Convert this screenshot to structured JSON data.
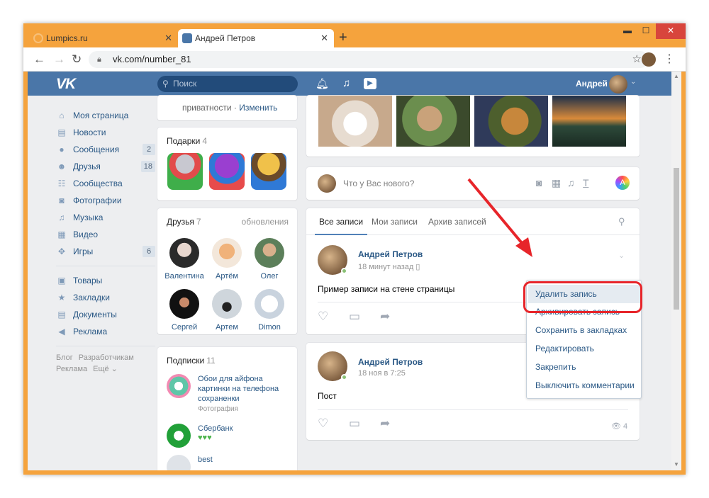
{
  "browser": {
    "tabs": [
      {
        "title": "Lumpics.ru",
        "active": false
      },
      {
        "title": "Андрей Петров",
        "active": true
      }
    ],
    "new_tab": "+",
    "url": "vk.com/number_81",
    "close_glyph": "✕",
    "minimize_glyph": "▬",
    "maximize_glyph": "☐"
  },
  "vk": {
    "logo": "VK",
    "search_placeholder": "Поиск",
    "user_name": "Андрей",
    "left_nav": [
      {
        "label": "Моя страница",
        "icon": "home-icon",
        "glyph": "⌂",
        "count": ""
      },
      {
        "label": "Новости",
        "icon": "news-icon",
        "glyph": "▤",
        "count": ""
      },
      {
        "label": "Сообщения",
        "icon": "messages-icon",
        "glyph": "●",
        "count": "2"
      },
      {
        "label": "Друзья",
        "icon": "friends-icon",
        "glyph": "☻",
        "count": "18"
      },
      {
        "label": "Сообщества",
        "icon": "communities-icon",
        "glyph": "☷",
        "count": ""
      },
      {
        "label": "Фотографии",
        "icon": "camera-icon",
        "glyph": "◙",
        "count": ""
      },
      {
        "label": "Музыка",
        "icon": "music-icon",
        "glyph": "♫",
        "count": ""
      },
      {
        "label": "Видео",
        "icon": "video-icon",
        "glyph": "▦",
        "count": ""
      },
      {
        "label": "Игры",
        "icon": "games-icon",
        "glyph": "✥",
        "count": "6"
      }
    ],
    "left_nav2": [
      {
        "label": "Товары",
        "icon": "goods-icon",
        "glyph": "▣"
      },
      {
        "label": "Закладки",
        "icon": "bookmarks-icon",
        "glyph": "★"
      },
      {
        "label": "Документы",
        "icon": "documents-icon",
        "glyph": "▤"
      },
      {
        "label": "Реклама",
        "icon": "ads-icon",
        "glyph": "◀"
      }
    ],
    "footer": [
      "Блог",
      "Разработчикам",
      "Реклама",
      "Ещё ⌄"
    ],
    "privacy": {
      "text": "приватности · ",
      "link": "Изменить"
    },
    "gifts": {
      "title": "Подарки",
      "count": "4"
    },
    "friends": {
      "title": "Друзья",
      "count": "7",
      "updates": "обновления",
      "list": [
        "Валентина",
        "Артём",
        "Олег",
        "Сергей",
        "Артем",
        "Dimon"
      ]
    },
    "subs": {
      "title": "Подписки",
      "count": "11",
      "list": [
        {
          "name": "Обои для айфона картинки на телефона сохраненки",
          "sub": "Фотография"
        },
        {
          "name": "Сбербанк",
          "sub": "♥♥♥"
        },
        {
          "name": "best",
          "sub": ""
        }
      ]
    },
    "new_post_placeholder": "Что у Вас нового?",
    "wall_tabs": [
      "Все записи",
      "Мои записи",
      "Архив записей"
    ],
    "posts": [
      {
        "author": "Андрей Петров",
        "time": "18 минут назад ▯",
        "text": "Пример записи на стене страницы",
        "views": ""
      },
      {
        "author": "Андрей Петров",
        "time": "18 ноя в 7:25",
        "text": "Пост",
        "views": "4"
      }
    ],
    "dropdown": [
      "Удалить запись",
      "Архивировать запись",
      "Сохранить в закладках",
      "Редактировать",
      "Закрепить",
      "Выключить комментарии"
    ]
  },
  "colors": {
    "accent": "#4a76a8",
    "link": "#2a5885",
    "highlight": "#e7252a",
    "browser_frame": "#f5a33d"
  }
}
